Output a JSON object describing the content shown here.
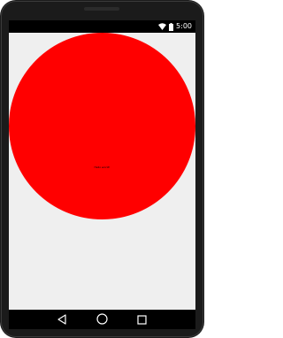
{
  "status_bar": {
    "time": "5:00",
    "icons": [
      "wifi-icon",
      "battery-icon"
    ]
  },
  "app": {
    "background_color": "#efefef",
    "circle_color": "#ff0000",
    "circle_label": "Hello world!"
  },
  "navigation": {
    "buttons": [
      "back-icon",
      "home-icon",
      "recents-icon"
    ]
  }
}
